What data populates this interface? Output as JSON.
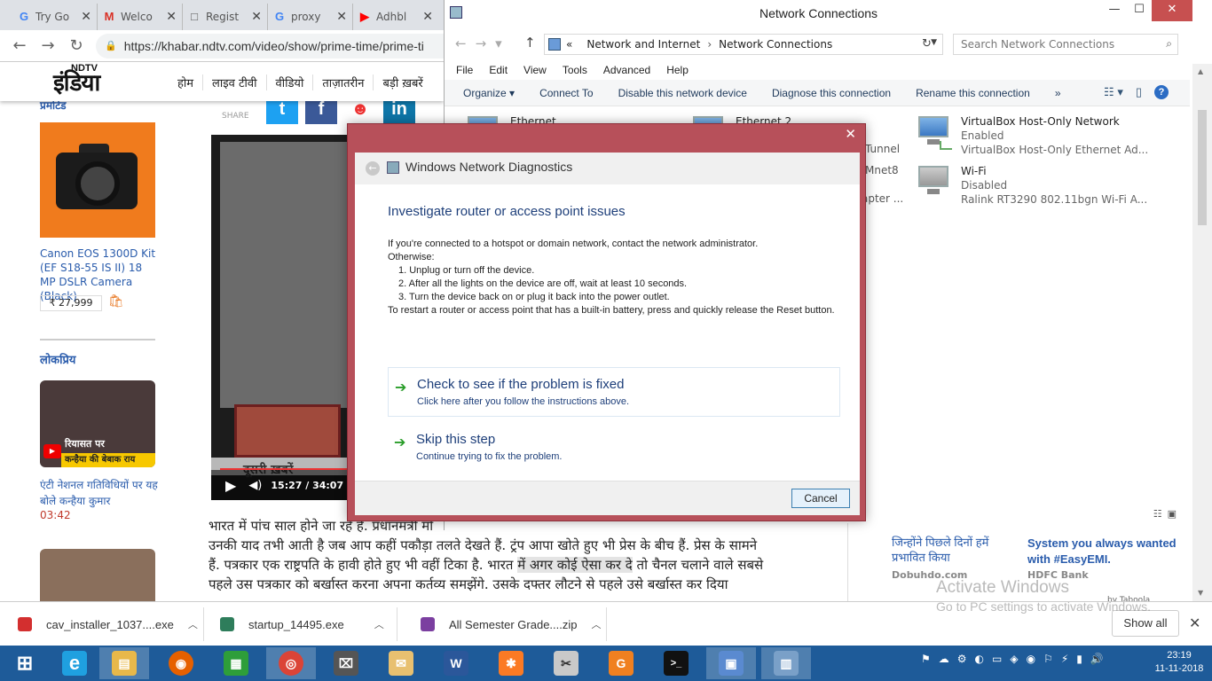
{
  "browser": {
    "tabs": [
      {
        "icon": "G",
        "icon_color": "#4285f4",
        "title": "Try Go"
      },
      {
        "icon": "M",
        "icon_color": "#d93025",
        "title": "Welco"
      },
      {
        "icon": "□",
        "icon_color": "#555555",
        "title": "Regist"
      },
      {
        "icon": "G",
        "icon_color": "#4285f4",
        "title": "proxy"
      },
      {
        "icon": "▶",
        "icon_color": "#ff0000",
        "title": "Adhbl"
      }
    ],
    "url": "https://khabar.ndtv.com/video/show/prime-time/prime-ti"
  },
  "site": {
    "logo": "NDTV",
    "logo_hindi": "इंडिया",
    "nav": [
      "होम",
      "लाइव टीवी",
      "वीडियो",
      "ताज़ातरीन",
      "बड़ी ख़बरें"
    ],
    "promo_heading": "प्रमोटेड",
    "promo_title": "Canon EOS 1300D Kit (EF S18-55 IS II) 18 MP DSLR Camera (Black)",
    "promo_price": "₹ 27,999",
    "popular_heading": "लोकप्रिय",
    "popular_overlay1": "रियासत पर",
    "popular_overlay2": "कन्हैया की बेबाक राय",
    "popular_title": "एंटी नेशनल गतिविधियों पर यह बोले कन्हैया कुमार",
    "popular_duration": "03:42",
    "share_label": "SHARE",
    "video_ticker": "दूसरी ख़बरें",
    "video_time": "15:27 / 34:07",
    "article_p1": "भारत में पांच साल होने जा रहे हैं. प्रधानमंत्री मो",
    "article_p2": "उनकी याद तभी आती है जब आप कहीं पकौड़ा तलते देखते हैं. ट्रंप आपा खोते हुए भी प्रेस के बीच हैं. प्रेस के सामने",
    "article_p3a": "हैं. पत्रकार एक राष्ट्रपति के हावी होते हुए भी वहीं टिका है. भारत ",
    "article_p3_hl": "में अगर कोई ऐसा कर दे",
    "article_p3b": " तो चैनल चलाने वाले सबसे",
    "article_p4": "पहले उस पत्रकार को बर्खास्त करना अपना कर्तव्य समझेंगे. उसके दफ्तर लौटने से पहले उसे बर्खास्त कर दिया"
  },
  "network_window": {
    "title": "Network Connections",
    "breadcrumb": [
      "Network and Internet",
      "Network Connections"
    ],
    "breadcrumb_prefix": "«",
    "search_placeholder": "Search Network Connections",
    "menu": [
      "File",
      "Edit",
      "View",
      "Tools",
      "Advanced",
      "Help"
    ],
    "commands": [
      "Organize ▾",
      "Connect To",
      "Disable this network device",
      "Diagnose this connection",
      "Rename this connection",
      "»"
    ],
    "adapters": [
      {
        "name": "Ethernet",
        "status": "",
        "device": ""
      },
      {
        "name": "Ethernet 2",
        "status": "",
        "device": ""
      },
      {
        "name": "VirtualBox Host-Only Network",
        "status": "Enabled",
        "device": "VirtualBox Host-Only Ethernet Ad..."
      },
      {
        "name": "Wi-Fi",
        "status": "Disabled",
        "device": "Ralink RT3290 802.11bgn Wi-Fi A..."
      }
    ],
    "hidden_fragments": [
      "Tunnel",
      "Mnet8",
      "apter ..."
    ]
  },
  "dialog": {
    "title": "Windows Network Diagnostics",
    "heading": "Investigate router or access point issues",
    "intro": "If you're connected to a hotspot or domain network, contact the network administrator.",
    "otherwise": "Otherwise:",
    "steps": [
      "1.  Unplug or turn off the device.",
      "2.  After all the lights on the device are off, wait at least 10 seconds.",
      "3.  Turn the device back on or plug it back into the power outlet."
    ],
    "reset_note": "To restart a router or access point that has a built-in battery, press and quickly release the Reset button.",
    "option1_title": "Check to see if the problem is fixed",
    "option1_sub": "Click here after you follow the instructions above.",
    "option2_title": "Skip this step",
    "option2_sub": "Continue trying to fix the problem.",
    "cancel": "Cancel"
  },
  "ads": {
    "ad1_title": "जिन्होंने पिछले दिनों हमें प्रभावित किया",
    "ad1_source": "Dobuhdo.com",
    "ad2_title": "System you always wanted with #EasyEMI.",
    "ad2_source": "HDFC Bank",
    "taboola": "by Taboola"
  },
  "watermark": {
    "line1": "Activate Windows",
    "line2": "Go to PC settings to activate Windows."
  },
  "downloads": {
    "items": [
      {
        "name": "cav_installer_1037....exe",
        "color": "#d32f2f"
      },
      {
        "name": "startup_14495.exe",
        "color": "#2e7d5b"
      },
      {
        "name": "All Semester Grade....zip",
        "color": "#7b3fa0"
      }
    ],
    "show_all": "Show all"
  },
  "taskbar": {
    "apps": [
      {
        "name": "start",
        "glyph": "⊞",
        "color": "#1e5b99"
      },
      {
        "name": "internet-explorer",
        "glyph": "e",
        "color": "#1fa0e0"
      },
      {
        "name": "file-explorer",
        "glyph": "▤",
        "color": "#e8b84a"
      },
      {
        "name": "firefox",
        "glyph": "◉",
        "color": "#e66000"
      },
      {
        "name": "store",
        "glyph": "▦",
        "color": "#2e9e3a"
      },
      {
        "name": "chrome",
        "glyph": "◎",
        "color": "#db4437"
      },
      {
        "name": "scanner",
        "glyph": "⌧",
        "color": "#555555"
      },
      {
        "name": "mail",
        "glyph": "✉",
        "color": "#e8c070"
      },
      {
        "name": "word",
        "glyph": "W",
        "color": "#2b579a"
      },
      {
        "name": "xampp",
        "glyph": "✱",
        "color": "#fb7a24"
      },
      {
        "name": "snipping",
        "glyph": "✂",
        "color": "#c9c9c9"
      },
      {
        "name": "pdf",
        "glyph": "G",
        "color": "#f08020"
      },
      {
        "name": "cmd",
        "glyph": ">_",
        "color": "#111111"
      },
      {
        "name": "control-panel",
        "glyph": "▣",
        "color": "#5a8ad0"
      },
      {
        "name": "network-diag",
        "glyph": "▥",
        "color": "#7aa0c8"
      }
    ],
    "tray_icons": [
      "⚑",
      "☁",
      "⚙",
      "◐",
      "▭",
      "◈",
      "◉",
      "⚐",
      "⚡",
      "▮",
      "🔊"
    ],
    "time": "23:19",
    "date": "11-11-2018"
  }
}
